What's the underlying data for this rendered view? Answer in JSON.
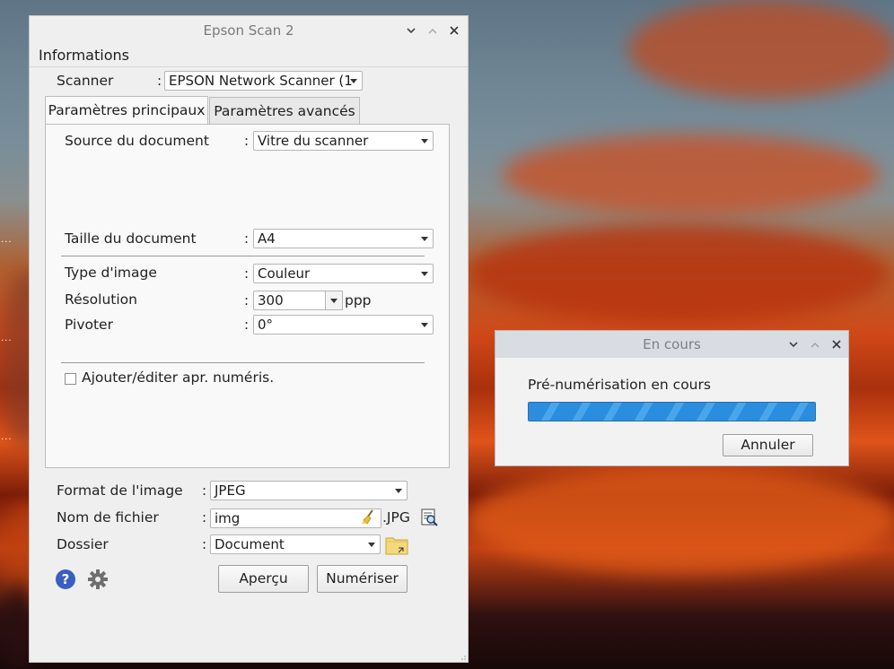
{
  "main_window": {
    "title": "Epson Scan 2",
    "info_label": "Informations",
    "scanner_label": "Scanner",
    "scanner_value": "EPSON Network Scanner (1",
    "tabs": [
      {
        "label": "Paramètres principaux",
        "active": true
      },
      {
        "label": "Paramètres avancés",
        "active": false
      }
    ],
    "doc_source_label": "Source du document",
    "doc_source_value": "Vitre du scanner",
    "doc_size_label": "Taille du document",
    "doc_size_value": "A4",
    "image_type_label": "Type d'image",
    "image_type_value": "Couleur",
    "resolution_label": "Résolution",
    "resolution_value": "300",
    "resolution_unit": "ppp",
    "rotate_label": "Pivoter",
    "rotate_value": "0°",
    "add_edit_label": "Ajouter/éditer apr. numéris.",
    "add_edit_checked": false,
    "image_format_label": "Format de l'image",
    "image_format_value": "JPEG",
    "filename_label": "Nom de fichier",
    "filename_value": "img",
    "filename_ext": ".JPG",
    "folder_label": "Dossier",
    "folder_value": "Document",
    "colon": ":",
    "preview_button": "Aperçu",
    "scan_button": "Numériser"
  },
  "progress_window": {
    "title": "En cours",
    "message": "Pré-numérisation en cours",
    "progress_fraction": 1.0,
    "cancel_button": "Annuler"
  },
  "colors": {
    "progress_accent": "#2a8ddd",
    "help_icon": "#3b5fc0"
  }
}
